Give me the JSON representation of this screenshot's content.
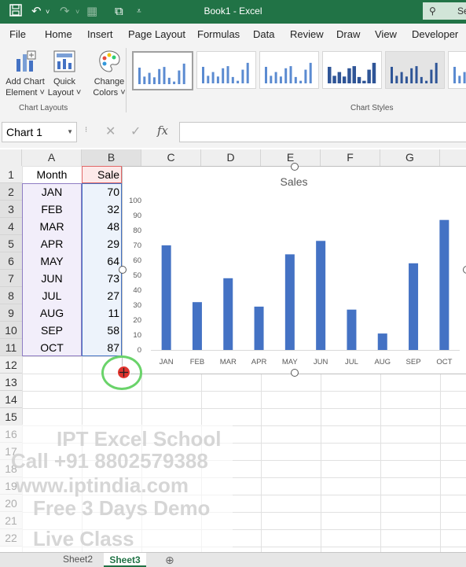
{
  "title_bar": {
    "title": "Book1 - Excel",
    "search_partial": "Se"
  },
  "menu_tabs": [
    "File",
    "Home",
    "Insert",
    "Page Layout",
    "Formulas",
    "Data",
    "Review",
    "Draw",
    "View",
    "Developer"
  ],
  "ribbon": {
    "add_chart_element": [
      "Add Chart",
      "Element ˅"
    ],
    "quick_layout": [
      "Quick",
      "Layout ˅"
    ],
    "change_colors": [
      "Change",
      "Colors ˅"
    ],
    "group_chart_layouts": "Chart Layouts",
    "group_chart_styles": "Chart Styles"
  },
  "formula_bar": {
    "name_box": "Chart 1",
    "fx": "fx"
  },
  "columns": [
    "A",
    "B",
    "C",
    "D",
    "E",
    "F",
    "G"
  ],
  "rows": [
    "1",
    "2",
    "3",
    "4",
    "5",
    "6",
    "7",
    "8",
    "9",
    "10",
    "11",
    "12",
    "13",
    "14",
    "15",
    "16",
    "17",
    "18",
    "19",
    "20",
    "21",
    "22"
  ],
  "table": {
    "header_a": "Month",
    "header_b": "Sale",
    "months": [
      "JAN",
      "FEB",
      "MAR",
      "APR",
      "MAY",
      "JUN",
      "JUL",
      "AUG",
      "SEP",
      "OCT"
    ],
    "sales": [
      "70",
      "32",
      "48",
      "29",
      "64",
      "73",
      "27",
      "11",
      "58",
      "87"
    ]
  },
  "sheet_tabs": [
    "Sheet2",
    "Sheet3"
  ],
  "watermark": [
    "IPT Excel School",
    "Call +91 8802579388",
    "www.iptindia.com",
    "Free 3 Days Demo",
    "Live Class"
  ],
  "colors": {
    "excel_green": "#217346",
    "bar_blue": "#4472c4"
  },
  "chart_data": {
    "type": "bar",
    "title": "Sales",
    "categories": [
      "JAN",
      "FEB",
      "MAR",
      "APR",
      "MAY",
      "JUN",
      "JUL",
      "AUG",
      "SEP",
      "OCT"
    ],
    "values": [
      70,
      32,
      48,
      29,
      64,
      73,
      27,
      11,
      58,
      87
    ],
    "ylim": [
      0,
      100
    ],
    "yticks": [
      "0",
      "10",
      "20",
      "30",
      "40",
      "50",
      "60",
      "70",
      "80",
      "90",
      "100"
    ],
    "grid": false,
    "legend": "none"
  }
}
